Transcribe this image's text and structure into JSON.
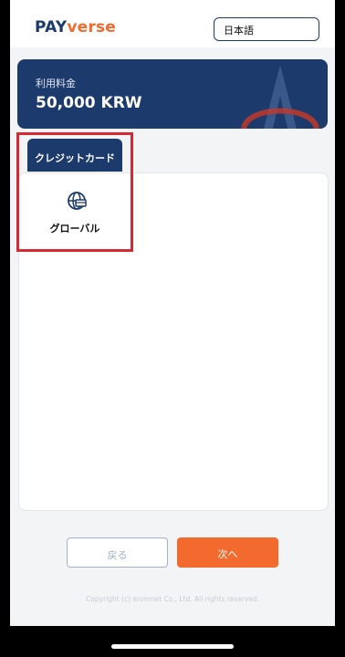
{
  "header": {
    "logo_prefix": "PAY",
    "logo_suffix": "verse",
    "language_selected": "日本語"
  },
  "amount": {
    "label": "利用料金",
    "value": "50,000 KRW"
  },
  "payment_methods": {
    "tab_label": "クレジットカード",
    "options": [
      {
        "label": "グローバル",
        "icon": "globe-card-icon"
      }
    ]
  },
  "buttons": {
    "back_label": "戻る",
    "next_label": "次へ"
  },
  "footer": {
    "copyright": "Copyright (c) eromnet Co., Ltd. All rights reserved."
  },
  "colors": {
    "brand_navy": "#1c3a6b",
    "brand_orange": "#f26a2e",
    "highlight_red": "#d42a33"
  }
}
